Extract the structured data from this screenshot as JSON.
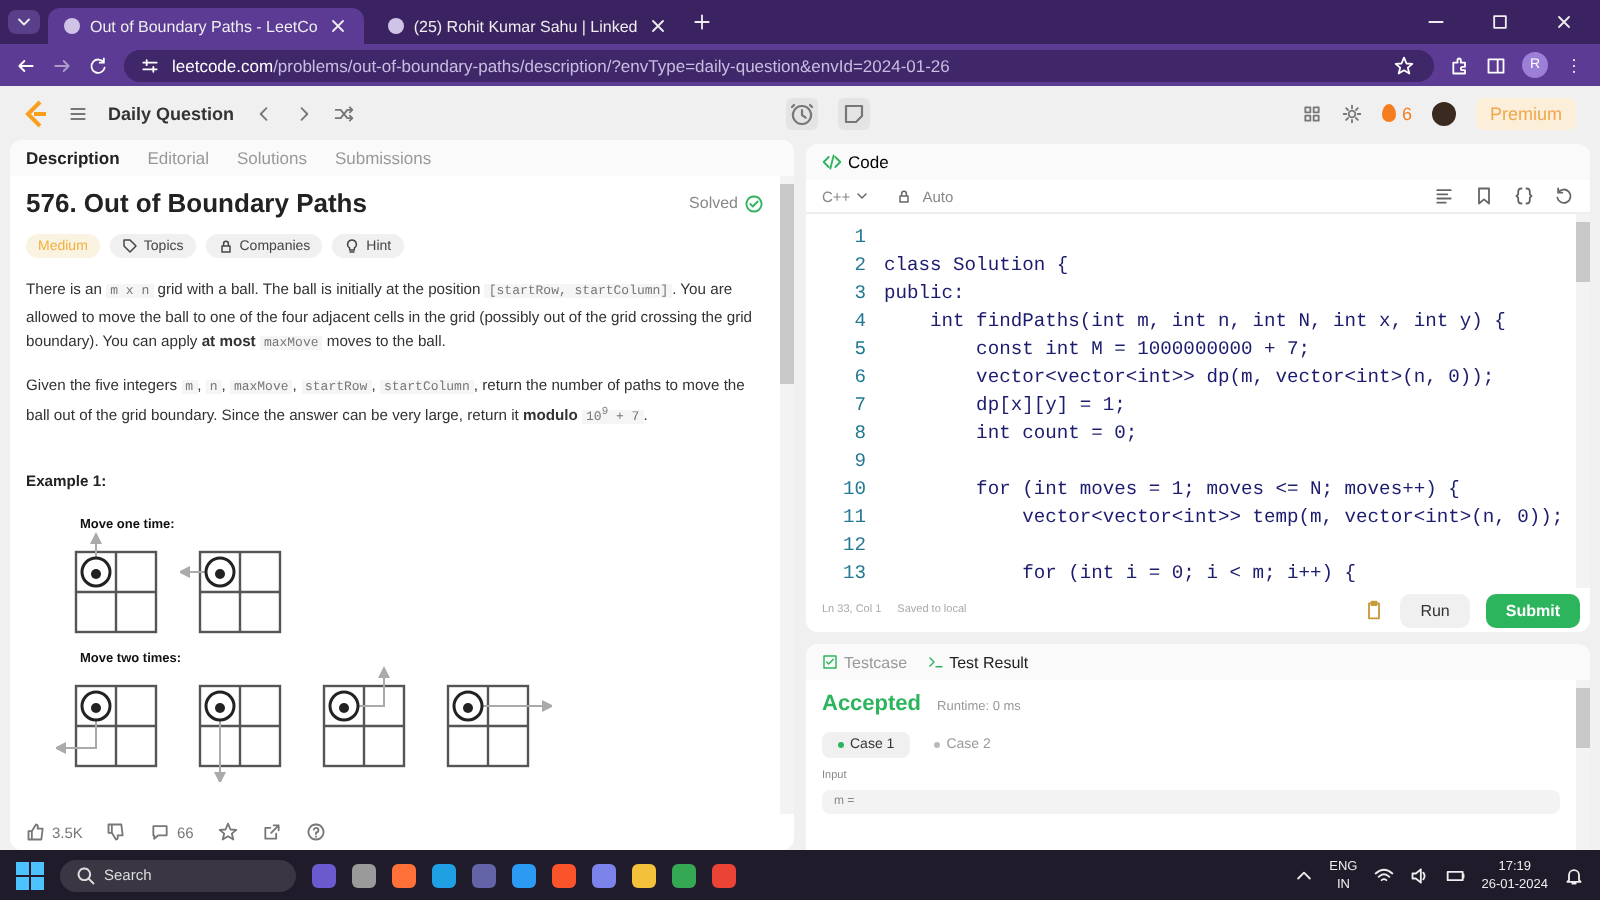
{
  "browser": {
    "tabs": [
      {
        "title": "Out of Boundary Paths - LeetCo",
        "selected": true
      },
      {
        "title": "(25) Rohit Kumar Sahu | Linked",
        "selected": false
      }
    ],
    "url_host": "leetcode.com",
    "url_path": "/problems/out-of-boundary-paths/description/?envType=daily-question&envId=2024-01-26",
    "profile": "R"
  },
  "nav": {
    "title": "Daily Question",
    "streak": "6",
    "premium": "Premium"
  },
  "description": {
    "tabs": [
      {
        "label": "Description",
        "selected": true
      },
      {
        "label": "Editorial",
        "selected": false
      },
      {
        "label": "Solutions",
        "selected": false
      },
      {
        "label": "Submissions",
        "selected": false
      }
    ],
    "title": "576. Out of Boundary Paths",
    "status": "Solved",
    "tags": [
      {
        "label": "Medium",
        "kind": "difficulty"
      },
      {
        "label": "Topics",
        "kind": "topics"
      },
      {
        "label": "Companies",
        "kind": "companies"
      },
      {
        "label": "Hint",
        "kind": "hint"
      }
    ],
    "paragraphs": [
      [
        {
          "kind": "text",
          "s": "There is an "
        },
        {
          "kind": "code",
          "s": "m x n"
        },
        {
          "kind": "text",
          "s": " grid with a ball. The ball is initially at the position "
        },
        {
          "kind": "code",
          "s": "[startRow, startColumn]"
        },
        {
          "kind": "text",
          "s": ". You are allowed to move the ball to one of the four adjacent cells in the grid (possibly out of the grid crossing the grid boundary). You can apply "
        },
        {
          "kind": "bold",
          "s": "at most "
        },
        {
          "kind": "code",
          "s": "maxMove"
        },
        {
          "kind": "text",
          "s": " moves to the ball."
        }
      ],
      [
        {
          "kind": "text",
          "s": "Given the five integers "
        },
        {
          "kind": "code",
          "s": "m"
        },
        {
          "kind": "text",
          "s": ", "
        },
        {
          "kind": "code",
          "s": "n"
        },
        {
          "kind": "text",
          "s": ", "
        },
        {
          "kind": "code",
          "s": "maxMove"
        },
        {
          "kind": "text",
          "s": ", "
        },
        {
          "kind": "code",
          "s": "startRow"
        },
        {
          "kind": "text",
          "s": ", "
        },
        {
          "kind": "code",
          "s": "startColumn"
        },
        {
          "kind": "text",
          "s": ", return the number of paths to move the ball out of the grid boundary. Since the answer can be very large, return it "
        },
        {
          "kind": "bold",
          "s": "modulo "
        },
        {
          "kind": "code",
          "s": "10$^{9}$ + 7"
        },
        {
          "kind": "text",
          "s": "."
        }
      ]
    ],
    "example_title": "Example 1:",
    "example_rows": [
      {
        "label": "Move one time:",
        "figures": [
          {
            "kind": "up"
          },
          {
            "kind": "left"
          }
        ]
      },
      {
        "label": "Move two times:",
        "figures": [
          {
            "kind": "down-left"
          },
          {
            "kind": "down"
          },
          {
            "kind": "right-up"
          },
          {
            "kind": "right"
          }
        ]
      }
    ],
    "likes": "3.5K",
    "comments": "66"
  },
  "editor": {
    "title": "Code",
    "language": "C++",
    "mode": "Auto",
    "lines": [
      {
        "n": "1"
      },
      {
        "n": "2",
        "code": "class Solution {"
      },
      {
        "n": "3",
        "code": "public:"
      },
      {
        "n": "4",
        "code": "    int findPaths(int m, int n, int N, int x, int y) {"
      },
      {
        "n": "5",
        "code": "        const int M = 1000000000 + 7;"
      },
      {
        "n": "6",
        "code": "        vector<vector<int>> dp(m, vector<int>(n, 0));"
      },
      {
        "n": "7",
        "code": "        dp[x][y] = 1;"
      },
      {
        "n": "8",
        "code": "        int count = 0;"
      },
      {
        "n": "9"
      },
      {
        "n": "10",
        "code": "        for (int moves = 1; moves <= N; moves++) {"
      },
      {
        "n": "11",
        "code": "            vector<vector<int>> temp(m, vector<int>(n, 0));"
      },
      {
        "n": "12"
      },
      {
        "n": "13",
        "code": "            for (int i = 0; i < m; i++) {"
      }
    ],
    "cursor": "Ln 33, Col 1",
    "saved": "Saved to local",
    "run": "Run",
    "submit": "Submit"
  },
  "result": {
    "tabs": [
      {
        "label": "Testcase",
        "selected": false
      },
      {
        "label": "Test Result",
        "selected": true
      }
    ],
    "verdict": "Accepted",
    "runtime": "Runtime: 0 ms",
    "cases": [
      {
        "label": "Case 1",
        "selected": true
      },
      {
        "label": "Case 2",
        "selected": false
      }
    ],
    "input_label": "Input",
    "input_value": "m ="
  },
  "taskbar": {
    "search": "Search",
    "lang": "ENG",
    "region": "IN",
    "time": "17:19",
    "date": "26-01-2024"
  }
}
